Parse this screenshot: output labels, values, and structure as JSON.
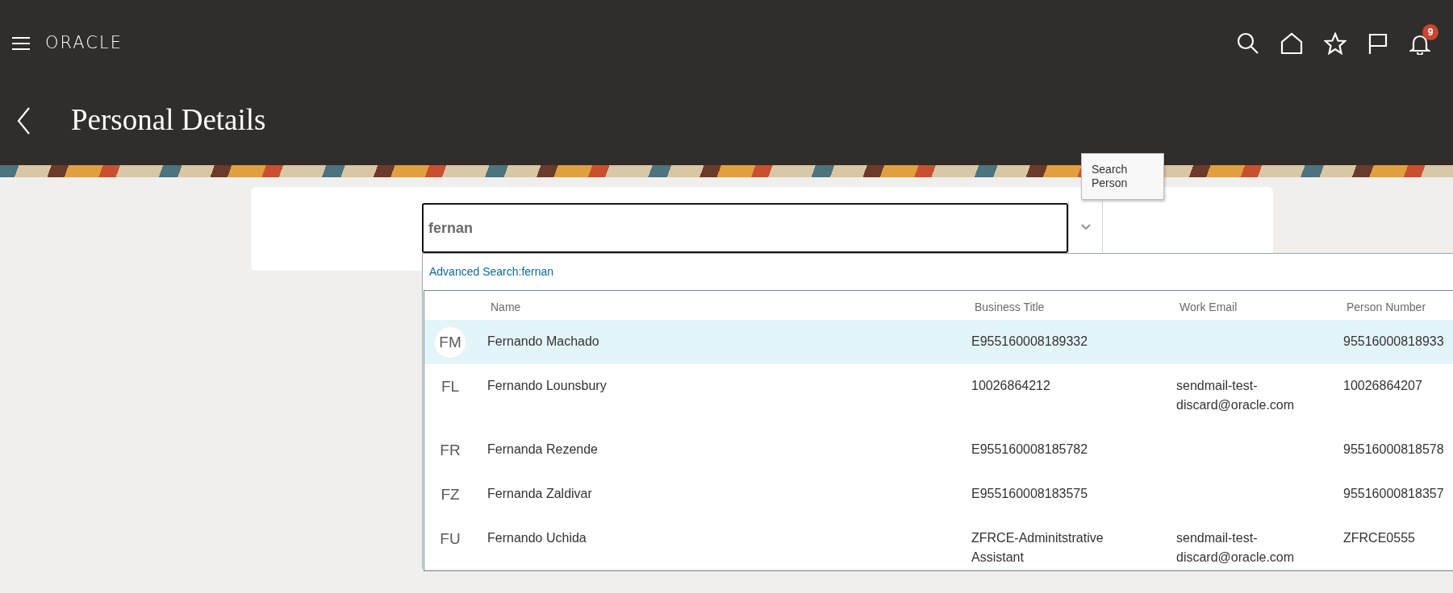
{
  "header": {
    "brand": "ORACLE",
    "notification_count": "9"
  },
  "page": {
    "title": "Personal Details"
  },
  "search": {
    "value": "fernan",
    "tooltip": "Search Person",
    "advanced_search_link": "Advanced Search:fernan"
  },
  "results": {
    "columns": [
      "Name",
      "Business Title",
      "Work Email",
      "Person Number"
    ],
    "rows": [
      {
        "initials": "FM",
        "name": "Fernando Machado",
        "business_title": "E955160008189332",
        "work_email": "",
        "person_number": "95516000818933",
        "selected": true
      },
      {
        "initials": "FL",
        "name": "Fernando Lounsbury",
        "business_title": "10026864212",
        "work_email": "sendmail-test-discard@oracle.com",
        "person_number": "10026864207",
        "selected": false
      },
      {
        "initials": "FR",
        "name": "Fernanda Rezende",
        "business_title": "E955160008185782",
        "work_email": "",
        "person_number": "95516000818578",
        "selected": false
      },
      {
        "initials": "FZ",
        "name": "Fernanda Zaldivar",
        "business_title": "E955160008183575",
        "work_email": "",
        "person_number": "95516000818357",
        "selected": false
      },
      {
        "initials": "FU",
        "name": "Fernando Uchida",
        "business_title": "ZFRCE-Adminitstrative Assistant",
        "work_email": "sendmail-test-discard@oracle.com",
        "person_number": "ZFRCE0555",
        "selected": false
      }
    ]
  }
}
